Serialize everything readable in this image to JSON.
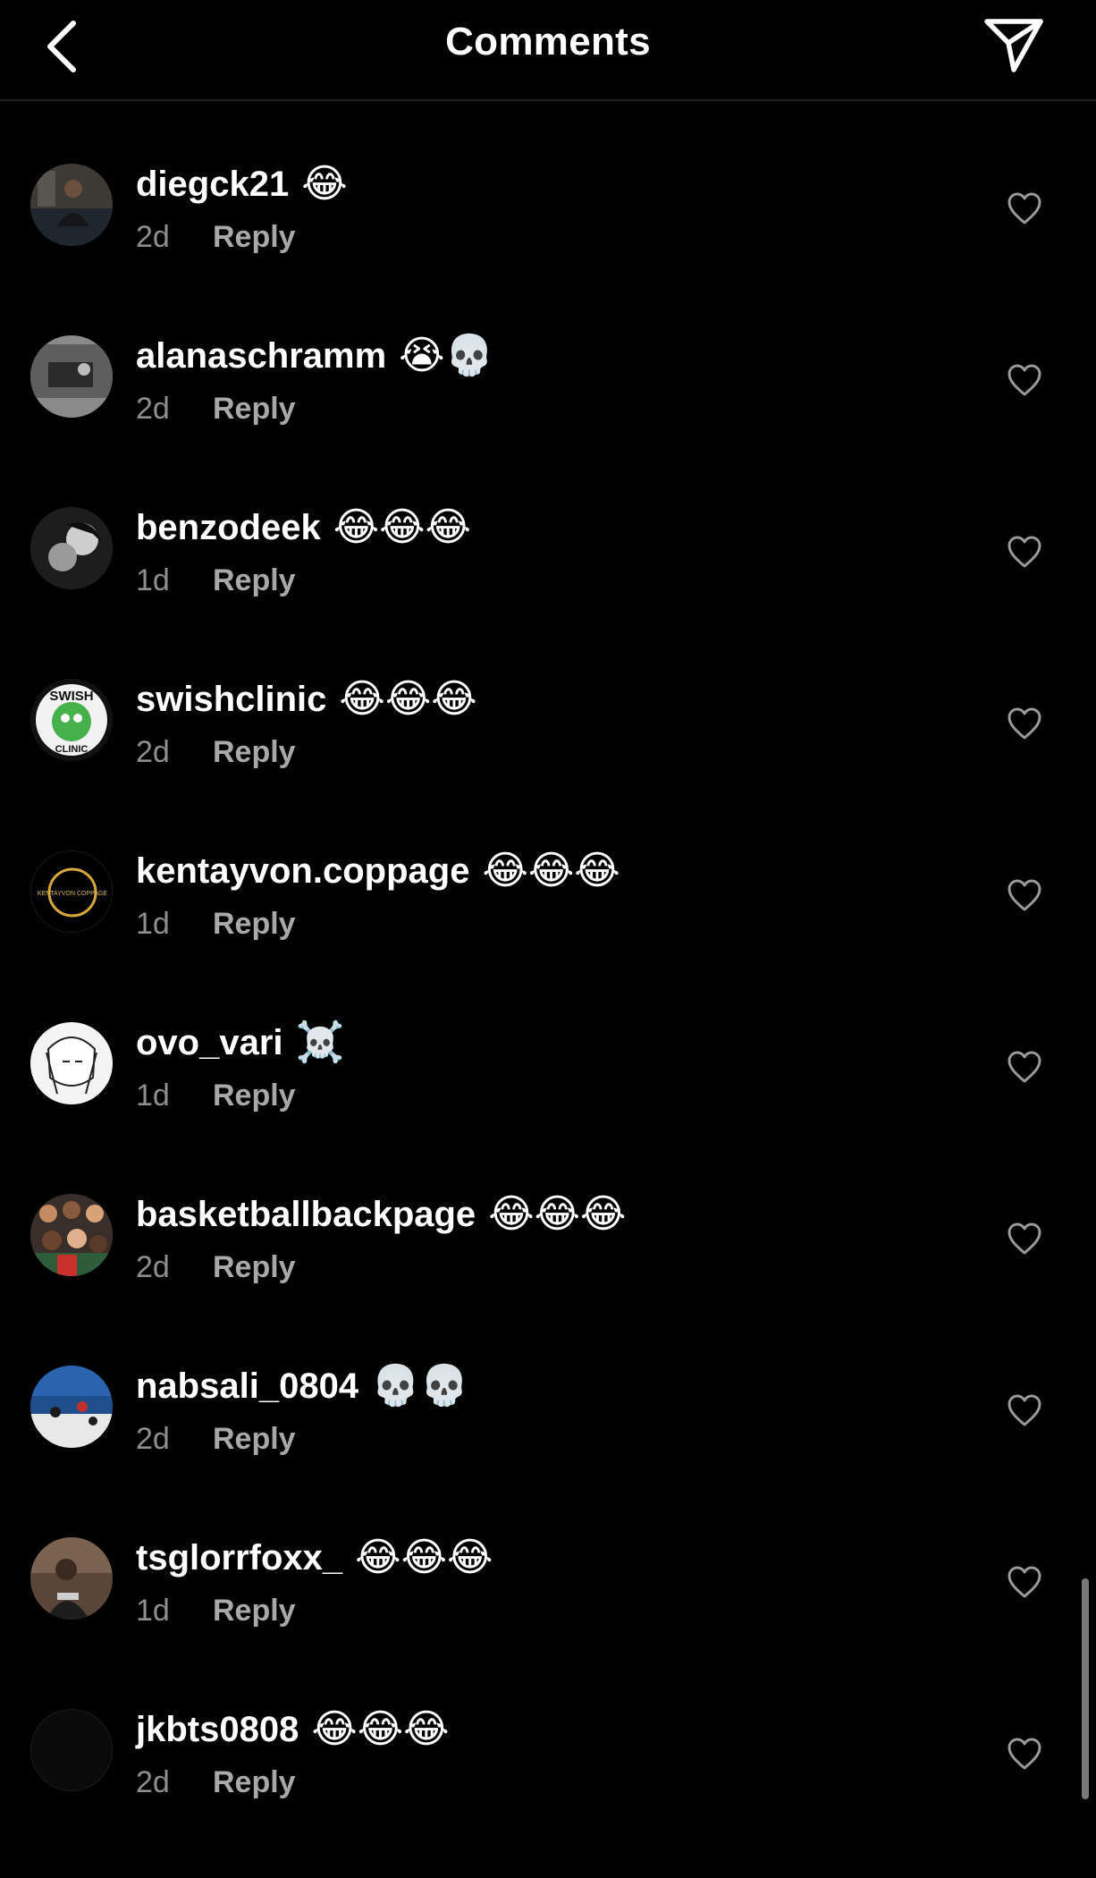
{
  "header": {
    "title": "Comments",
    "back_icon": "chevron-left-icon",
    "share_icon": "paper-plane-icon"
  },
  "comments": [
    {
      "username": "diegck21",
      "emojis": "😂",
      "time": "2d",
      "reply": "Reply"
    },
    {
      "username": "alanaschramm",
      "emojis": "😭💀",
      "time": "2d",
      "reply": "Reply"
    },
    {
      "username": "benzodeek",
      "emojis": "😂😂😂",
      "time": "1d",
      "reply": "Reply"
    },
    {
      "username": "swishclinic",
      "emojis": "😂😂😂",
      "time": "2d",
      "reply": "Reply",
      "avatar_text": "SWISH CLINIC"
    },
    {
      "username": "kentayvon.coppage",
      "emojis": "😂😂😂",
      "time": "1d",
      "reply": "Reply",
      "avatar_text": "KENTAYVON COPPAGE"
    },
    {
      "username": "ovo_vari",
      "emojis": "☠️",
      "time": "1d",
      "reply": "Reply"
    },
    {
      "username": "basketballbackpage",
      "emojis": "😂😂😂",
      "time": "2d",
      "reply": "Reply"
    },
    {
      "username": "nabsali_0804",
      "emojis": "💀💀",
      "time": "2d",
      "reply": "Reply"
    },
    {
      "username": "tsglorrfoxx_",
      "emojis": "😂😂😂",
      "time": "1d",
      "reply": "Reply"
    },
    {
      "username": "jkbts0808",
      "emojis": "😂😂😂",
      "time": "2d",
      "reply": "Reply"
    }
  ],
  "colors": {
    "background": "#000000",
    "text_primary": "#ffffff",
    "text_secondary": "#8e8e8e",
    "divider": "#1f1f1f"
  }
}
